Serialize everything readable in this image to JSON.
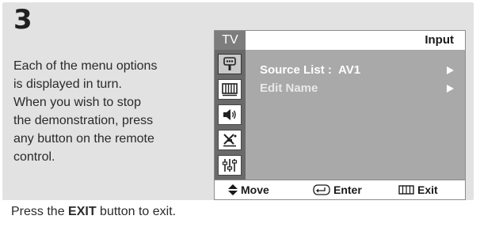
{
  "step": {
    "number": "3"
  },
  "instructions": {
    "lines": [
      "Each of the menu options",
      "is displayed in turn.",
      "When you wish to stop",
      "the demonstration, press",
      "any button on the remote",
      "control."
    ]
  },
  "footer": {
    "prefix": "Press the ",
    "button": "EXIT",
    "suffix": " button to exit."
  },
  "osd": {
    "tab_label": "TV",
    "title": "Input",
    "rows": [
      {
        "label": "Source List",
        "separator": ":",
        "value": "AV1"
      },
      {
        "label": "Edit Name"
      }
    ],
    "hints": {
      "move": "Move",
      "enter": "Enter",
      "exit": "Exit"
    },
    "sidebar_icons": [
      "input-icon",
      "picture-icon",
      "sound-icon",
      "channel-icon",
      "setup-icon"
    ]
  }
}
